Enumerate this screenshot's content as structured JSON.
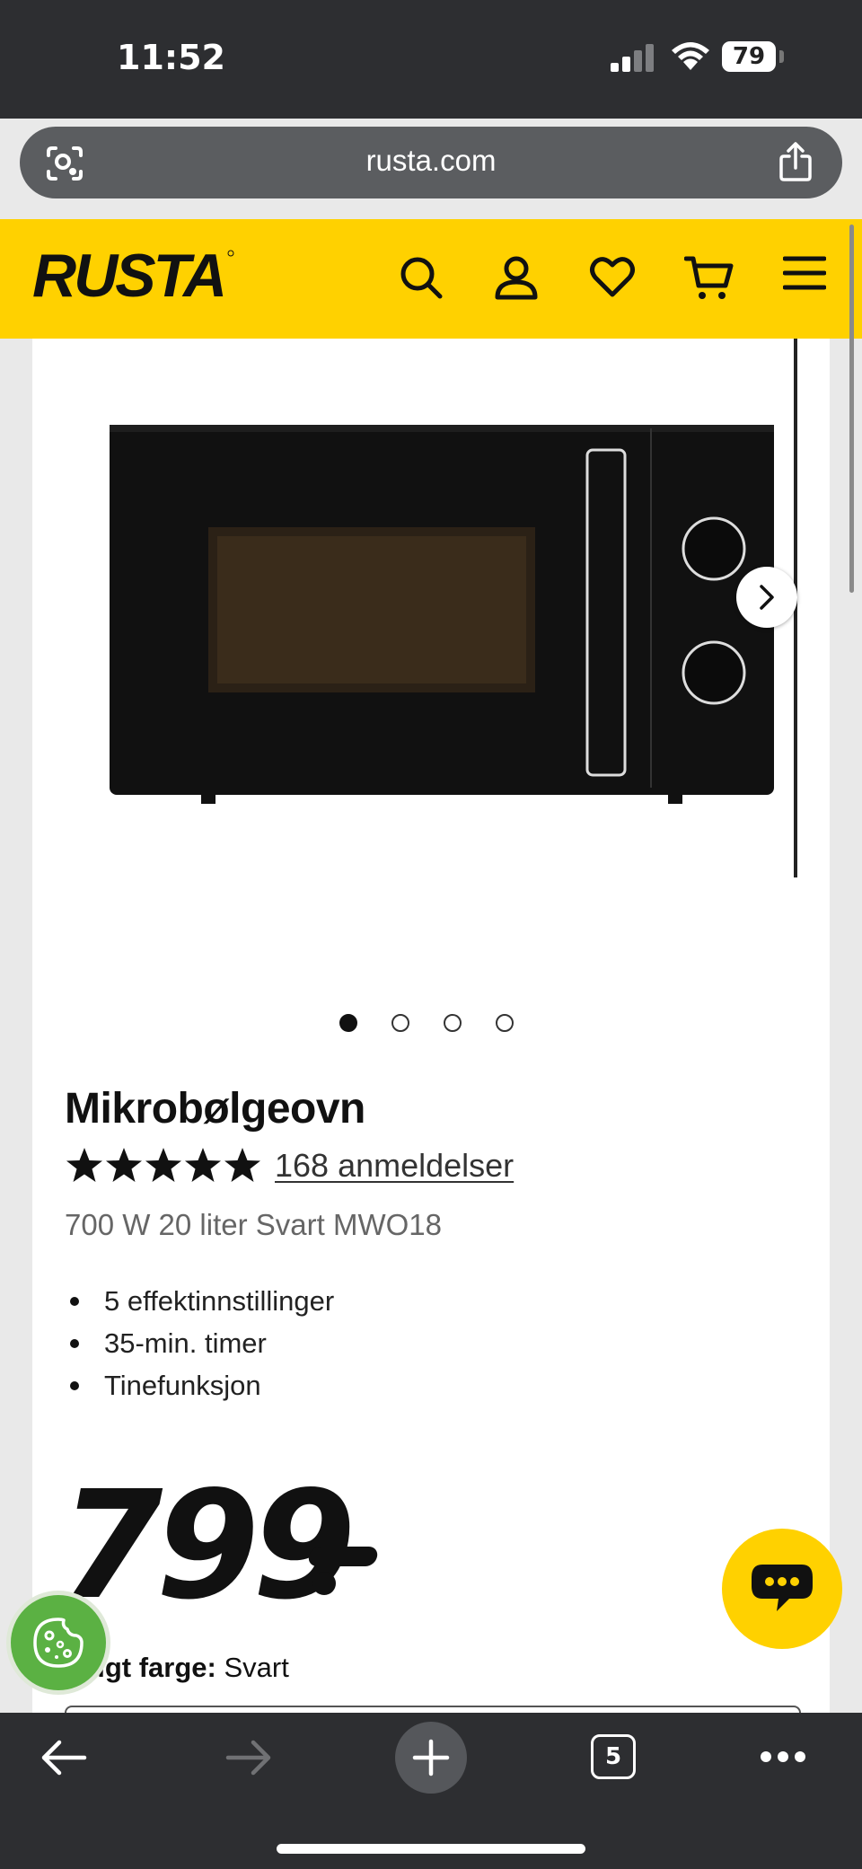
{
  "status_bar": {
    "time": "11:52",
    "battery": "79"
  },
  "browser": {
    "url": "rusta.com",
    "open_tabs": "5"
  },
  "site": {
    "brand": "RUSTA"
  },
  "product": {
    "image_count": 4,
    "active_image": 1,
    "title": "Mikrobølgeovn",
    "rating": 5,
    "reviews_link": "168 anmeldelser",
    "subtitle": "700 W 20 liter Svart MWO18",
    "features": [
      "5 effektinnstillinger",
      "35-min. timer",
      "Tinefunksjon"
    ],
    "price": "799",
    "color_label": "Valgt farge:",
    "color_value": "Svart"
  },
  "colors": {
    "brand_yellow": "#ffd100",
    "cookie_green": "#5bb143",
    "chrome_dark": "#2d2e31"
  },
  "icons": {
    "header": [
      "search-icon",
      "account-icon",
      "heart-icon",
      "cart-icon",
      "menu-icon"
    ],
    "toolbar": [
      "back-arrow-icon",
      "forward-arrow-icon",
      "plus-icon",
      "tabs-icon",
      "more-icon"
    ]
  }
}
